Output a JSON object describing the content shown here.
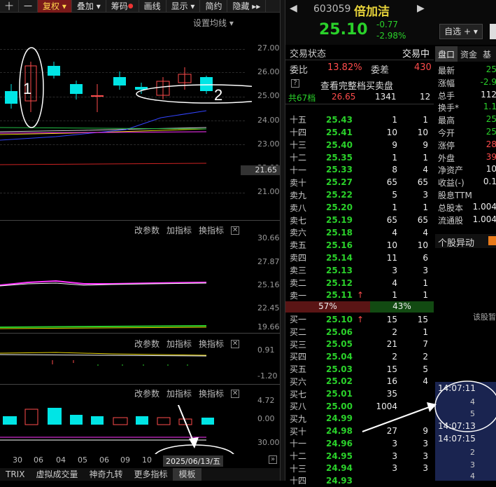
{
  "toolbar": {
    "items": [
      "十",
      "一",
      "复权 ▾",
      "叠加 ▾",
      "筹码",
      "画线",
      "显示 ▾",
      "简约",
      "隐藏 ▸▸"
    ]
  },
  "main_chart": {
    "ma_setting": "设置均线 ▾",
    "price_ticks": [
      "27.00",
      "26.00",
      "25.00",
      "24.00",
      "23.00",
      "22.00",
      "21.00"
    ],
    "current_price_tag": "21.65",
    "annotation_1": "1",
    "annotation_2": "2"
  },
  "indicator_panels": [
    {
      "actions": [
        "改参数",
        "加指标",
        "换指标"
      ],
      "ticks": [
        "30.66",
        "27.87",
        "25.16",
        "22.45",
        "19.66"
      ]
    },
    {
      "actions": [
        "改参数",
        "加指标",
        "换指标"
      ],
      "ticks": [
        "0.91",
        "-1.20"
      ]
    },
    {
      "actions": [
        "改参数",
        "加指标",
        "换指标"
      ],
      "ticks": [
        "4.72",
        "0.00",
        "30.00"
      ]
    }
  ],
  "x_axis": {
    "ticks": [
      "30",
      "06",
      "04",
      "05",
      "06",
      "09",
      "10"
    ],
    "date_label": "2025/06/13/五"
  },
  "bottom_tabs": [
    "TRIX",
    "虚拟成交量",
    "神奇九转",
    "更多指标",
    "模板"
  ],
  "stock": {
    "code": "603059",
    "name": "倍加洁",
    "price": "25.10",
    "change": "-0.77",
    "change_pct": "-2.98%",
    "watch_button": "自选 + ▾"
  },
  "status": {
    "label": "交易状态",
    "value": "交易中",
    "ratio_label": "委比",
    "ratio": "13.82%",
    "diff_label": "委差",
    "diff": "430",
    "full_book": "查看完整档买卖盘",
    "help": "?",
    "total_label": "共67档",
    "total_price": "26.65",
    "total_vol": "1341",
    "total_cnt": "12"
  },
  "asks": [
    {
      "label": "十五",
      "price": "25.43",
      "vol": "1",
      "chg": "1"
    },
    {
      "label": "十四",
      "price": "25.41",
      "vol": "10",
      "chg": "10"
    },
    {
      "label": "十三",
      "price": "25.40",
      "vol": "9",
      "chg": "9"
    },
    {
      "label": "十二",
      "price": "25.35",
      "vol": "1",
      "chg": "1"
    },
    {
      "label": "十一",
      "price": "25.33",
      "vol": "8",
      "chg": "4"
    },
    {
      "label": "卖十",
      "price": "25.27",
      "vol": "65",
      "chg": "65"
    },
    {
      "label": "卖九",
      "price": "25.22",
      "vol": "5",
      "chg": "3"
    },
    {
      "label": "卖八",
      "price": "25.20",
      "vol": "1",
      "chg": "1"
    },
    {
      "label": "卖七",
      "price": "25.19",
      "vol": "65",
      "chg": "65"
    },
    {
      "label": "卖六",
      "price": "25.18",
      "vol": "4",
      "chg": "4"
    },
    {
      "label": "卖五",
      "price": "25.16",
      "vol": "10",
      "chg": "10"
    },
    {
      "label": "卖四",
      "price": "25.14",
      "vol": "11",
      "chg": "6"
    },
    {
      "label": "卖三",
      "price": "25.13",
      "vol": "3",
      "chg": "3"
    },
    {
      "label": "卖二",
      "price": "25.12",
      "vol": "4",
      "chg": "1"
    },
    {
      "label": "卖一",
      "price": "25.11",
      "vol": "1",
      "chg": "1"
    }
  ],
  "split": {
    "buy_pct": "57%",
    "sell_pct": "43%"
  },
  "bids": [
    {
      "label": "买一",
      "price": "25.10",
      "vol": "15",
      "chg": "15"
    },
    {
      "label": "买二",
      "price": "25.06",
      "vol": "2",
      "chg": "1"
    },
    {
      "label": "买三",
      "price": "25.05",
      "vol": "21",
      "chg": "7"
    },
    {
      "label": "买四",
      "price": "25.04",
      "vol": "2",
      "chg": "2"
    },
    {
      "label": "买五",
      "price": "25.03",
      "vol": "15",
      "chg": "5"
    },
    {
      "label": "买六",
      "price": "25.02",
      "vol": "16",
      "chg": "4"
    },
    {
      "label": "买七",
      "price": "25.01",
      "vol": "35",
      "chg": ""
    },
    {
      "label": "买八",
      "price": "25.00",
      "vol": "1004",
      "chg": ""
    },
    {
      "label": "买九",
      "price": "24.99",
      "vol": "",
      "chg": ""
    },
    {
      "label": "买十",
      "price": "24.98",
      "vol": "27",
      "chg": "9"
    },
    {
      "label": "十一",
      "price": "24.96",
      "vol": "3",
      "chg": "3"
    },
    {
      "label": "十二",
      "price": "24.95",
      "vol": "3",
      "chg": "3"
    },
    {
      "label": "十三",
      "price": "24.94",
      "vol": "3",
      "chg": "3"
    },
    {
      "label": "十四",
      "price": "24.93",
      "vol": "",
      "chg": ""
    }
  ],
  "side_tabs": [
    "盘口",
    "资金",
    "基"
  ],
  "side_info": [
    {
      "k": "最新",
      "v": "25"
    },
    {
      "k": "涨幅",
      "v": "-2.9"
    },
    {
      "k": "总手",
      "v": "112"
    },
    {
      "k": "换手*",
      "v": "1.1"
    },
    {
      "k": "最高",
      "v": "25"
    },
    {
      "k": "今开",
      "v": "25"
    },
    {
      "k": "涨停",
      "v": "28"
    },
    {
      "k": "外盘",
      "v": "39"
    },
    {
      "k": "净资产",
      "v": "10"
    },
    {
      "k": "收益(-)",
      "v": "0.1"
    },
    {
      "k": "股息TTM",
      "v": ""
    },
    {
      "k": "总股本",
      "v": "1.004"
    },
    {
      "k": "流通股",
      "v": "1.004"
    }
  ],
  "anomaly": {
    "title": "个股异动",
    "hint": "该股暂"
  },
  "ticks_list": [
    {
      "time": "14:07:11",
      "vals": [
        "4",
        "5"
      ]
    },
    {
      "time": "14:07:13",
      "vals": []
    },
    {
      "time": "14:07:15",
      "vals": [
        "2",
        "3",
        "4"
      ]
    }
  ],
  "colors": {
    "up": "#ff4c4c",
    "down": "#00e5e5",
    "green": "#2ad12a",
    "yellow": "#e8d43a"
  }
}
